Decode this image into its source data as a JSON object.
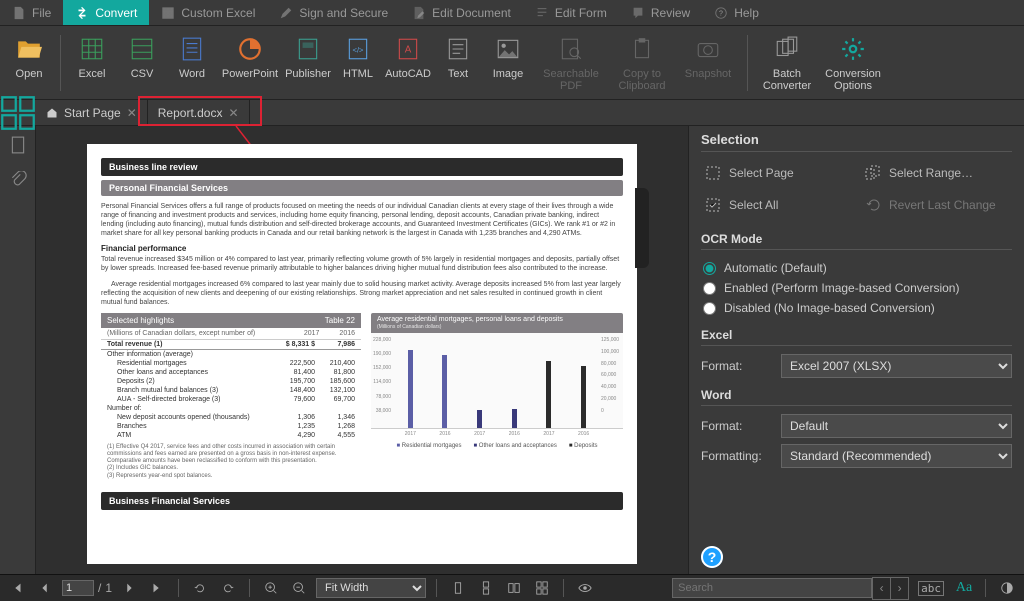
{
  "menu": {
    "file": "File",
    "convert": "Convert",
    "customExcel": "Custom Excel",
    "signSecure": "Sign and Secure",
    "editDoc": "Edit Document",
    "editForm": "Edit Form",
    "review": "Review",
    "help": "Help"
  },
  "ribbon": {
    "open": "Open",
    "excel": "Excel",
    "csv": "CSV",
    "word": "Word",
    "ppt": "PowerPoint",
    "publisher": "Publisher",
    "html": "HTML",
    "autocad": "AutoCAD",
    "text": "Text",
    "image": "Image",
    "searchable": "Searchable PDF",
    "clipboard": "Copy to Clipboard",
    "snapshot": "Snapshot",
    "batch": "Batch Converter",
    "options": "Conversion Options"
  },
  "tabs": {
    "start": "Start Page",
    "doc": "Report.docx"
  },
  "panel": {
    "selection": "Selection",
    "selectPage": "Select Page",
    "selectRange": "Select Range…",
    "selectAll": "Select All",
    "revert": "Revert Last Change",
    "ocr": "OCR Mode",
    "ocrAuto": "Automatic (Default)",
    "ocrEnabled": "Enabled (Perform Image-based Conversion)",
    "ocrDisabled": "Disabled (No Image-based Conversion)",
    "excel": "Excel",
    "word": "Word",
    "formatLabel": "Format:",
    "formattingLabel": "Formatting:",
    "excelFormat": "Excel 2007 (XLSX)",
    "wordFormat": "Default",
    "wordFormatting": "Standard (Recommended)"
  },
  "doc": {
    "bar1": "Business line review",
    "bar2": "Personal Financial Services",
    "para1": "Personal Financial Services offers a full range of products focused on meeting the needs of our individual Canadian clients at every stage of their lives through a wide range of financing and investment products and services, including home equity financing, personal lending, deposit accounts, Canadian private banking, indirect lending (including auto financing), mutual funds distribution and self-directed brokerage accounts, and Guaranteed Investment Certificates (GICs). We rank #1 or #2 in market share for all key personal banking products in Canada and our retail banking network is the largest in Canada with 1,235 branches and 4,290 ATMs.",
    "fpTitle": "Financial performance",
    "para2": "Total revenue increased $345 million or 4% compared to last year, primarily reflecting volume growth of 5% largely in residential mortgages and deposits, partially offset by lower spreads. Increased fee-based revenue primarily attributable to higher balances driving higher mutual fund distribution fees also contributed to the increase.",
    "para3": "Average residential mortgages increased 6% compared to last year mainly due to solid housing market activity. Average deposits increased 5% from last year largely reflecting the acquisition of new clients and deepening of our existing relationships. Strong market appreciation and net sales resulted in continued growth in client mutual fund balances.",
    "tblTitle": "Selected highlights",
    "tblNo": "Table 22",
    "tblSub": "(Millions of Canadian dollars, except number of)",
    "y1": "2017",
    "y2": "2016",
    "rows": [
      {
        "l": "Total revenue (1)",
        "a": "$    8,331 $",
        "b": "7,986",
        "hd": true
      },
      {
        "l": "Other information (average)",
        "a": "",
        "b": ""
      },
      {
        "l": "Residential mortgages",
        "a": "222,500",
        "b": "210,400",
        "in": true
      },
      {
        "l": "Other loans and acceptances",
        "a": "81,400",
        "b": "81,800",
        "in": true
      },
      {
        "l": "Deposits (2)",
        "a": "195,700",
        "b": "185,600",
        "in": true
      },
      {
        "l": "Branch mutual fund balances (3)",
        "a": "148,400",
        "b": "132,100",
        "in": true
      },
      {
        "l": "AUA - Self-directed brokerage (3)",
        "a": "79,600",
        "b": "69,700",
        "in": true
      },
      {
        "l": "Number of:",
        "a": "",
        "b": ""
      },
      {
        "l": "New deposit accounts opened (thousands)",
        "a": "1,306",
        "b": "1,346",
        "in": true
      },
      {
        "l": "Branches",
        "a": "1,235",
        "b": "1,268",
        "in": true
      },
      {
        "l": "ATM",
        "a": "4,290",
        "b": "4,555",
        "in": true
      }
    ],
    "foot": [
      "(1)   Effective Q4 2017, service fees and other costs incurred in association with certain commissions and fees earned are presented on a gross basis in non-interest expense. Comparative amounts have been reclassified to conform with this presentation.",
      "(2)   Includes GIC balances.",
      "(3)   Represents year-end spot balances."
    ],
    "bar3": "Business Financial Services"
  },
  "chart_data": {
    "type": "bar",
    "title": "Average residential mortgages, personal loans and deposits",
    "subtitle": "(Millions of Canadian dollars)",
    "categories": [
      "2017",
      "2016",
      "2017",
      "2016",
      "2017",
      "2016"
    ],
    "series": [
      {
        "name": "Residential mortgages",
        "values": [
          222500,
          210400,
          null,
          null,
          null,
          null
        ],
        "color": "#5b5ea6"
      },
      {
        "name": "Other loans and acceptances",
        "values": [
          null,
          null,
          81400,
          81800,
          null,
          null
        ],
        "color": "#39397a"
      },
      {
        "name": "Deposits",
        "values": [
          null,
          null,
          null,
          null,
          195700,
          185600
        ],
        "color": "#2b2b2b"
      }
    ],
    "ylim": [
      38000,
      228000
    ],
    "y2lim": [
      0,
      125000
    ],
    "yticks": [
      228000,
      190000,
      152000,
      114000,
      78000,
      38000
    ],
    "y2ticks": [
      125000,
      100000,
      80000,
      60000,
      40000,
      20000,
      0
    ],
    "legend": [
      "Residential mortgages",
      "Other loans and acceptances",
      "Deposits"
    ]
  },
  "status": {
    "page": "1",
    "pages": "1",
    "zoom": "Fit Width",
    "searchPlaceholder": "Search",
    "abc": "abc",
    "aa": "Aa"
  },
  "colors": {
    "accent": "#13a89e",
    "highlight": "#d23"
  }
}
